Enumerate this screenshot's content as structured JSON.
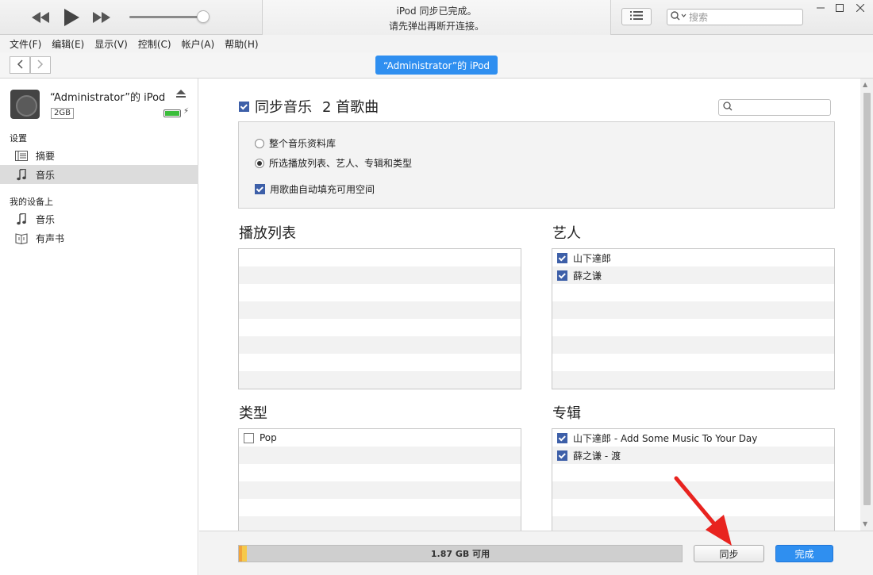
{
  "window": {
    "lcd_line1": "iPod 同步已完成。",
    "lcd_line2": "请先弹出再断开连接。",
    "search_placeholder": "搜索"
  },
  "menu": [
    "文件(F)",
    "编辑(E)",
    "显示(V)",
    "控制(C)",
    "帐户(A)",
    "帮助(H)"
  ],
  "device": {
    "pill_label": "“Administrator”的 iPod",
    "name": "“Administrator”的 iPod",
    "capacity": "2GB"
  },
  "sidebar": {
    "settings_header": "设置",
    "settings_items": [
      {
        "label": "摘要",
        "icon": "summary-icon"
      },
      {
        "label": "音乐",
        "icon": "music-note-icon"
      }
    ],
    "ondevice_header": "我的设备上",
    "ondevice_items": [
      {
        "label": "音乐",
        "icon": "music-note-icon"
      },
      {
        "label": "有声书",
        "icon": "audiobook-icon"
      }
    ]
  },
  "main": {
    "sync_label": "同步音乐",
    "sync_count": "2 首歌曲",
    "options": {
      "entire_library": "整个音乐资料库",
      "selected": "所选播放列表、艺人、专辑和类型",
      "autofill": "用歌曲自动填充可用空间"
    },
    "playlists": {
      "title": "播放列表",
      "items": []
    },
    "artists": {
      "title": "艺人",
      "items": [
        "山下達郎",
        "薛之谦"
      ]
    },
    "genres": {
      "title": "类型",
      "items": [
        "Pop"
      ]
    },
    "albums": {
      "title": "专辑",
      "items": [
        "山下達郎 - Add Some Music To Your Day",
        "薛之谦 - 渡"
      ]
    }
  },
  "footer": {
    "capacity_text": "1.87 GB 可用",
    "sync_button": "同步",
    "done_button": "完成"
  },
  "colors": {
    "accent": "#2f8ff0",
    "annotation_arrow": "#e8231f"
  }
}
